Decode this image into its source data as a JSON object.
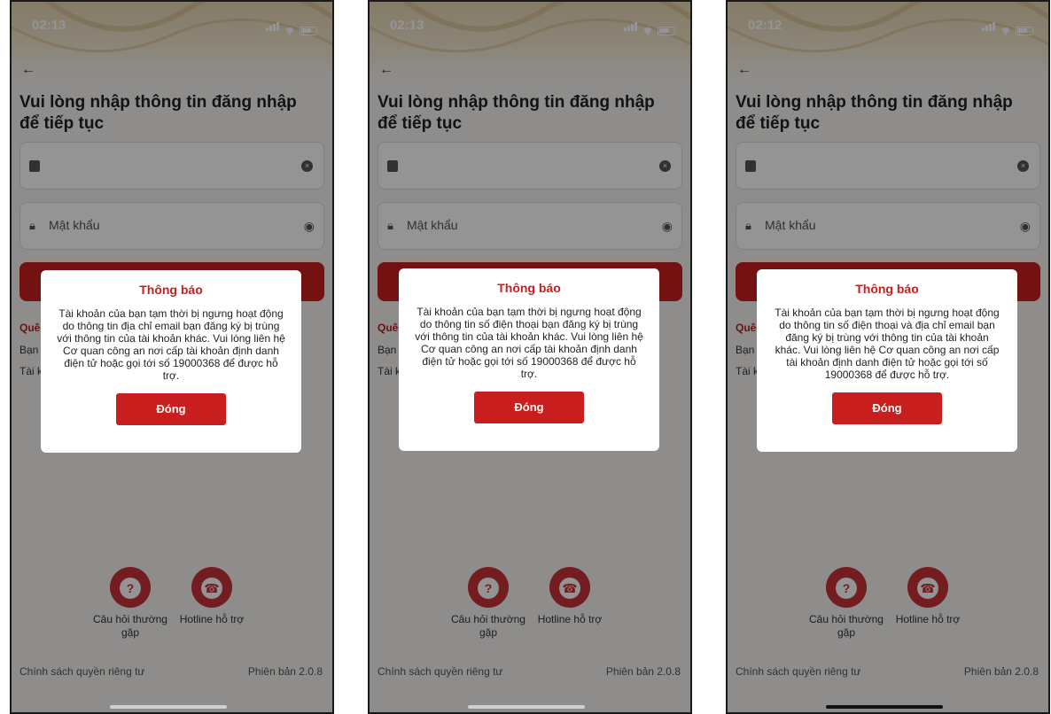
{
  "phones": [
    {
      "status_time": "02:13",
      "heading": "Vui lòng nhập thông tin đăng nhập để tiếp tục",
      "password_placeholder": "Mật khẩu",
      "side_text_1": "Quê",
      "side_text_2": "Bạn",
      "side_text_3": "Tài k",
      "dialog_title": "Thông báo",
      "dialog_body": "Tài khoản của bạn tạm thời bị ngưng hoạt động do thông tin địa chỉ email bạn đăng ký bị trùng với thông tin của tài khoản khác. Vui lòng liên hệ Cơ quan công an nơi cấp tài khoản định danh điện tử hoặc gọi tới số 19000368 để được hỗ trợ.",
      "dialog_button": "Đóng",
      "faq_label": "Câu hỏi thường gặp",
      "hotline_label": "Hotline hỗ trợ",
      "privacy": "Chính sách quyền riêng tư",
      "version": "Phiên bản 2.0.8"
    },
    {
      "status_time": "02:13",
      "heading": "Vui lòng nhập thông tin đăng nhập để tiếp tục",
      "password_placeholder": "Mật khẩu",
      "side_text_1": "Quê",
      "side_text_2": "Bạn",
      "side_text_3": "Tài k",
      "dialog_title": "Thông báo",
      "dialog_body": "Tài khoản của bạn tạm thời bị ngưng hoạt động do thông tin số điện thoại bạn đăng ký bị trùng với thông tin của tài khoản khác. Vui lòng liên hệ Cơ quan công an nơi cấp tài khoản định danh điện tử hoặc gọi tới số 19000368 để được hỗ trợ.",
      "dialog_button": "Đóng",
      "faq_label": "Câu hỏi thường gặp",
      "hotline_label": "Hotline hỗ trợ",
      "privacy": "Chính sách quyền riêng tư",
      "version": "Phiên bản 2.0.8"
    },
    {
      "status_time": "02:12",
      "heading": "Vui lòng nhập thông tin đăng nhập để tiếp tục",
      "password_placeholder": "Mật khẩu",
      "side_text_1": "Quê",
      "side_text_2": "Bạn",
      "side_text_3": "Tài k",
      "dialog_title": "Thông báo",
      "dialog_body": "Tài khoản của bạn tạm thời bị ngưng hoạt động do thông tin số điện thoại và địa chỉ email bạn đăng ký bị trùng với thông tin của tài khoản khác. Vui lòng liên hệ Cơ quan công an nơi cấp tài khoản định danh điện tử hoặc gọi tới số 19000368 để được hỗ trợ.",
      "dialog_button": "Đóng",
      "faq_label": "Câu hỏi thường gặp",
      "hotline_label": "Hotline hỗ trợ",
      "privacy": "Chính sách quyền riêng tư",
      "version": "Phiên bản 2.0.8"
    }
  ],
  "colors": {
    "brand_red": "#c81e1e",
    "overlay": "rgba(0,0,0,0.42)",
    "support_icon": "#c8323a"
  },
  "icons": [
    "back-arrow-icon",
    "id-card-icon",
    "clear-icon",
    "lock-icon",
    "eye-icon",
    "question-icon",
    "hotline-icon"
  ]
}
